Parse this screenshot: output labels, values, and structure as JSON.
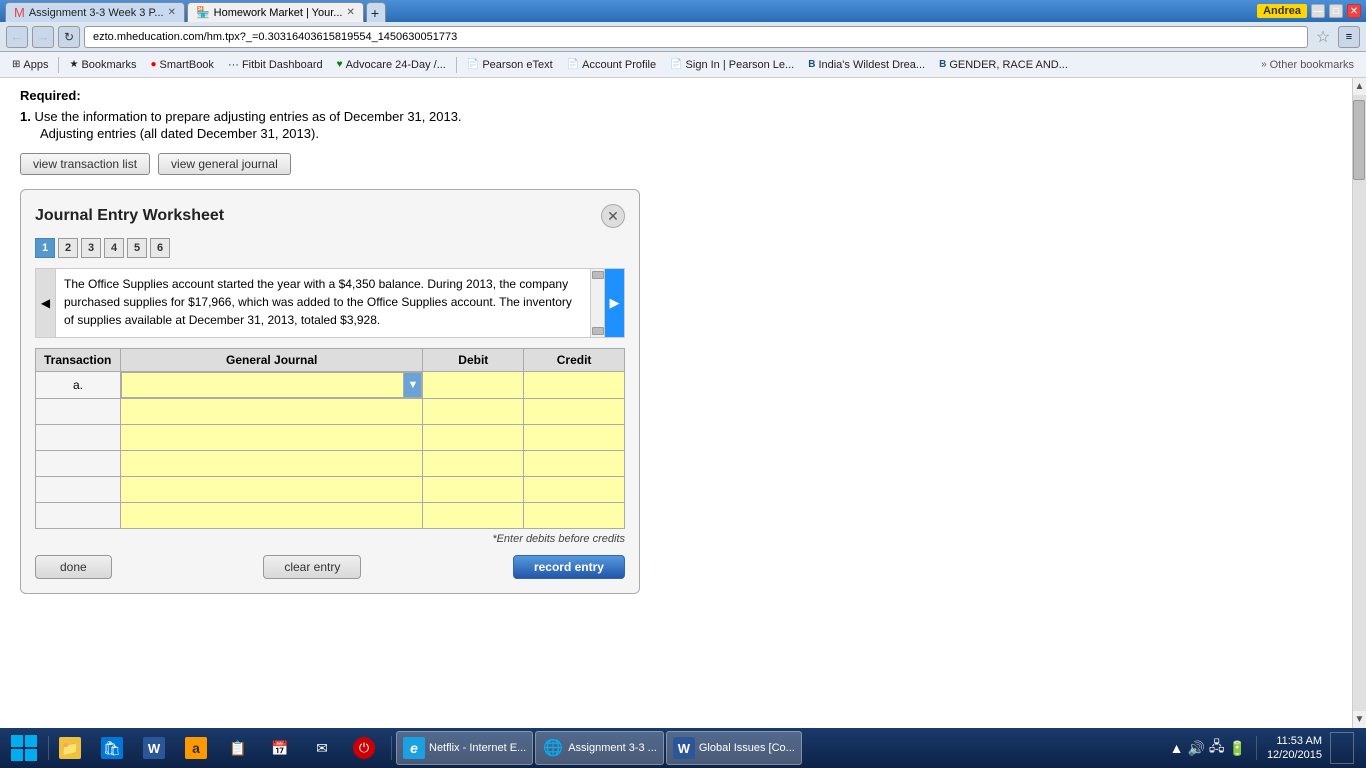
{
  "titlebar": {
    "user": "Andrea",
    "tabs": [
      {
        "id": "tab1",
        "label": "Assignment 3-3 Week 3 P...",
        "active": false
      },
      {
        "id": "tab2",
        "label": "Homework Market | Your...",
        "active": true
      }
    ],
    "controls": [
      "minimize",
      "maximize",
      "close"
    ]
  },
  "browser": {
    "address": "ezto.mheducation.com/hm.tpx?_=0.30316403615819554_1450630051773",
    "star_icon": "☆",
    "menu_icon": "≡"
  },
  "bookmarks": [
    {
      "id": "apps",
      "label": "Apps",
      "icon": "⊞"
    },
    {
      "id": "bookmarks",
      "label": "Bookmarks",
      "icon": "★"
    },
    {
      "id": "smartbook",
      "label": "SmartBook",
      "icon": "🔴"
    },
    {
      "id": "fitbit",
      "label": "Fitbit Dashboard",
      "icon": "···"
    },
    {
      "id": "advocare",
      "label": "Advocare 24-Day /...",
      "icon": "💚"
    },
    {
      "id": "pearson-etext",
      "label": "Pearson eText",
      "icon": "📄"
    },
    {
      "id": "account-profile",
      "label": "Account Profile",
      "icon": "📄"
    },
    {
      "id": "sign-in-pearson",
      "label": "Sign In | Pearson Le...",
      "icon": "📄"
    },
    {
      "id": "indias-wildest",
      "label": "India's Wildest Drea...",
      "icon": "B"
    },
    {
      "id": "gender-race",
      "label": "GENDER, RACE AND...",
      "icon": "B"
    },
    {
      "id": "other-bookmarks",
      "label": "Other bookmarks",
      "icon": "📁"
    }
  ],
  "page": {
    "required_label": "Required:",
    "instruction_number": "1.",
    "instruction_text": "Use the information to prepare adjusting entries as of December 31, 2013.",
    "sub_instruction": "Adjusting entries (all dated December 31, 2013).",
    "btn_view_transaction": "view transaction list",
    "btn_view_journal": "view general journal"
  },
  "modal": {
    "title": "Journal Entry Worksheet",
    "close_icon": "✕",
    "steps": [
      "1",
      "2",
      "3",
      "4",
      "5",
      "6"
    ],
    "active_step": 0,
    "description": "The Office Supplies account started the year with a $4,350 balance. During 2013, the company purchased supplies for $17,966, which was added to the Office Supplies account. The inventory of supplies available at December 31, 2013, totaled $3,928.",
    "table": {
      "headers": [
        "Transaction",
        "General Journal",
        "Debit",
        "Credit"
      ],
      "rows": [
        {
          "transaction": "a.",
          "general_journal": "",
          "debit": "",
          "credit": ""
        },
        {
          "transaction": "",
          "general_journal": "",
          "debit": "",
          "credit": ""
        },
        {
          "transaction": "",
          "general_journal": "",
          "debit": "",
          "credit": ""
        },
        {
          "transaction": "",
          "general_journal": "",
          "debit": "",
          "credit": ""
        },
        {
          "transaction": "",
          "general_journal": "",
          "debit": "",
          "credit": ""
        },
        {
          "transaction": "",
          "general_journal": "",
          "debit": "",
          "credit": ""
        }
      ]
    },
    "hint": "*Enter debits before credits",
    "btn_done": "done",
    "btn_clear": "clear entry",
    "btn_record": "record entry"
  },
  "taskbar": {
    "apps": [
      {
        "id": "start",
        "icon": "⊞",
        "label": ""
      },
      {
        "id": "file-explorer",
        "icon": "📁",
        "label": ""
      },
      {
        "id": "store",
        "icon": "🛍",
        "label": ""
      },
      {
        "id": "word",
        "icon": "W",
        "label": ""
      },
      {
        "id": "amazon",
        "icon": "a",
        "label": ""
      },
      {
        "id": "doc",
        "icon": "📋",
        "label": ""
      },
      {
        "id": "calendar",
        "icon": "📅",
        "label": ""
      },
      {
        "id": "mail",
        "icon": "✉",
        "label": ""
      },
      {
        "id": "power",
        "icon": "⏻",
        "label": ""
      },
      {
        "id": "ie",
        "icon": "e",
        "label": "Netflix - Internet E..."
      },
      {
        "id": "chrome",
        "icon": "◉",
        "label": "Assignment 3-3 ..."
      },
      {
        "id": "word-app",
        "icon": "W",
        "label": "Global Issues [Co..."
      }
    ],
    "clock": {
      "time": "11:53 AM",
      "date": "12/20/2015"
    },
    "tray": [
      "▲",
      "🔊",
      "🖧",
      "🔋"
    ]
  }
}
